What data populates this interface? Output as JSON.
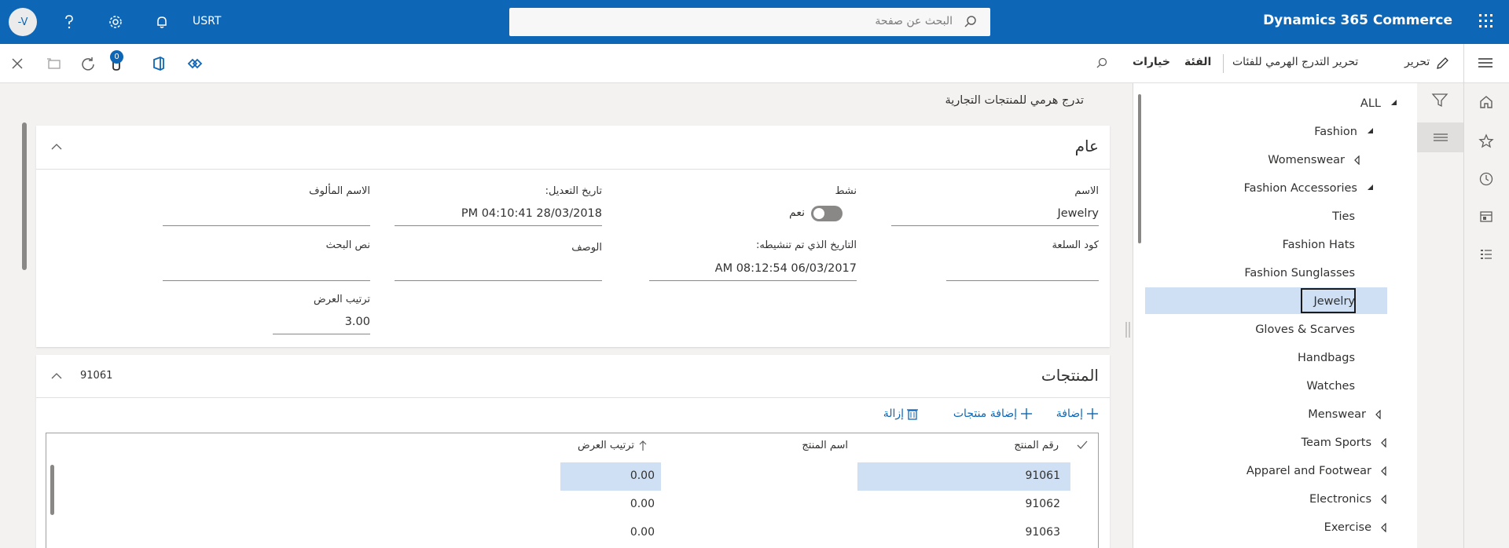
{
  "topbar": {
    "avatar_initials": "-V",
    "company": "USRT",
    "search_placeholder": "البحث عن صفحة",
    "brand": "Dynamics 365 Commerce",
    "icons": [
      "help-icon",
      "settings-icon",
      "bell-icon",
      "app-launcher-icon",
      "search-icon"
    ]
  },
  "actionbar": {
    "edit": "تحرير",
    "edit_hierarchy": "تحرير التدرج الهرمي للفئات",
    "category": "الفئة",
    "options": "خيارات",
    "attachments_count": "0"
  },
  "page_title": "تدرج هرمي للمنتجات التجارية",
  "tree": {
    "items": [
      {
        "label": "ALL",
        "arrow": "expanded"
      },
      {
        "label": "Fashion",
        "arrow": "expanded"
      },
      {
        "label": "Womenswear",
        "arrow": "collapsed"
      },
      {
        "label": "Fashion Accessories",
        "arrow": "expanded"
      },
      {
        "label": "Ties",
        "arrow": "none"
      },
      {
        "label": "Fashion Hats",
        "arrow": "none"
      },
      {
        "label": "Fashion Sunglasses",
        "arrow": "none"
      },
      {
        "label": "Jewelry",
        "arrow": "none",
        "selected": true
      },
      {
        "label": "Gloves & Scarves",
        "arrow": "none"
      },
      {
        "label": "Handbags",
        "arrow": "none"
      },
      {
        "label": "Watches",
        "arrow": "none"
      },
      {
        "label": "Menswear",
        "arrow": "collapsed"
      },
      {
        "label": "Team Sports",
        "arrow": "collapsed"
      },
      {
        "label": "Apparel and Footwear",
        "arrow": "collapsed"
      },
      {
        "label": "Electronics",
        "arrow": "collapsed"
      },
      {
        "label": "Exercise",
        "arrow": "collapsed"
      }
    ]
  },
  "general": {
    "title": "عام",
    "name_label": "الاسم",
    "name_value": "Jewelry",
    "active_label": "نشط",
    "active_value": "نعم",
    "modified_label": "تاريخ التعديل:",
    "modified_value": "PM 04:10:41 28/03/2018",
    "friendly_name_label": "الاسم المألوف",
    "friendly_name_value": "",
    "code_label": "كود السلعة",
    "code_value": "",
    "activated_label": "التاريخ الذي تم تنشيطه:",
    "activated_value": "AM 08:12:54 06/03/2017",
    "description_label": "الوصف",
    "description_value": "",
    "search_text_label": "نص البحث",
    "search_text_value": "",
    "display_order_label": "ترتيب العرض",
    "display_order_value": "3.00"
  },
  "products": {
    "title": "المنتجات",
    "summary": "91061",
    "add": "إضافة",
    "add_products": "إضافة منتجات",
    "remove": "إزالة",
    "columns": {
      "product_number": "رقم المنتج",
      "product_name": "اسم المنتج",
      "display_order": "ترتيب العرض"
    },
    "rows": [
      {
        "number": "91061",
        "name": "",
        "order": "0.00",
        "selected": true
      },
      {
        "number": "91062",
        "name": "",
        "order": "0.00"
      },
      {
        "number": "91063",
        "name": "",
        "order": "0.00"
      }
    ]
  },
  "colors": {
    "brand": "#0e67b6",
    "selection": "#cfe0f4"
  }
}
